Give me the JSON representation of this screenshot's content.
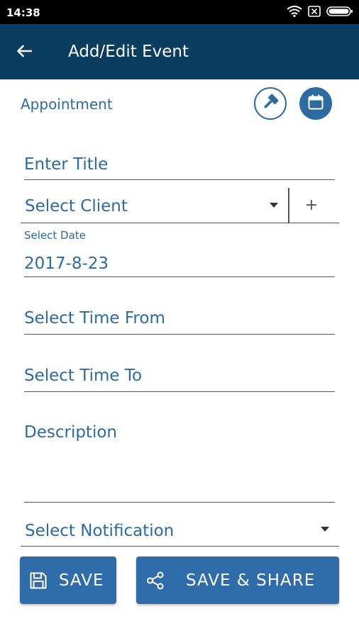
{
  "status_bar": {
    "time": "14:38",
    "icons": [
      "wifi-icon",
      "close-box-icon",
      "battery-icon"
    ]
  },
  "app_bar": {
    "title": "Add/Edit Event",
    "back_icon": "arrow-left-icon"
  },
  "form": {
    "category": "Appointment",
    "title_placeholder": "Enter Title",
    "client_placeholder": "Select Client",
    "client_add": "+",
    "date_label": "Select Date",
    "date_value": "2017-8-23",
    "time_from_placeholder": "Select Time From",
    "time_to_placeholder": "Select Time To",
    "description_placeholder": "Description",
    "notification_placeholder": "Select Notification"
  },
  "actions": {
    "save": "SAVE",
    "save_share": "SAVE & SHARE"
  },
  "colors": {
    "app_bar": "#0a3d5f",
    "accent": "#2c6aa0",
    "button": "#2f6ca9"
  }
}
